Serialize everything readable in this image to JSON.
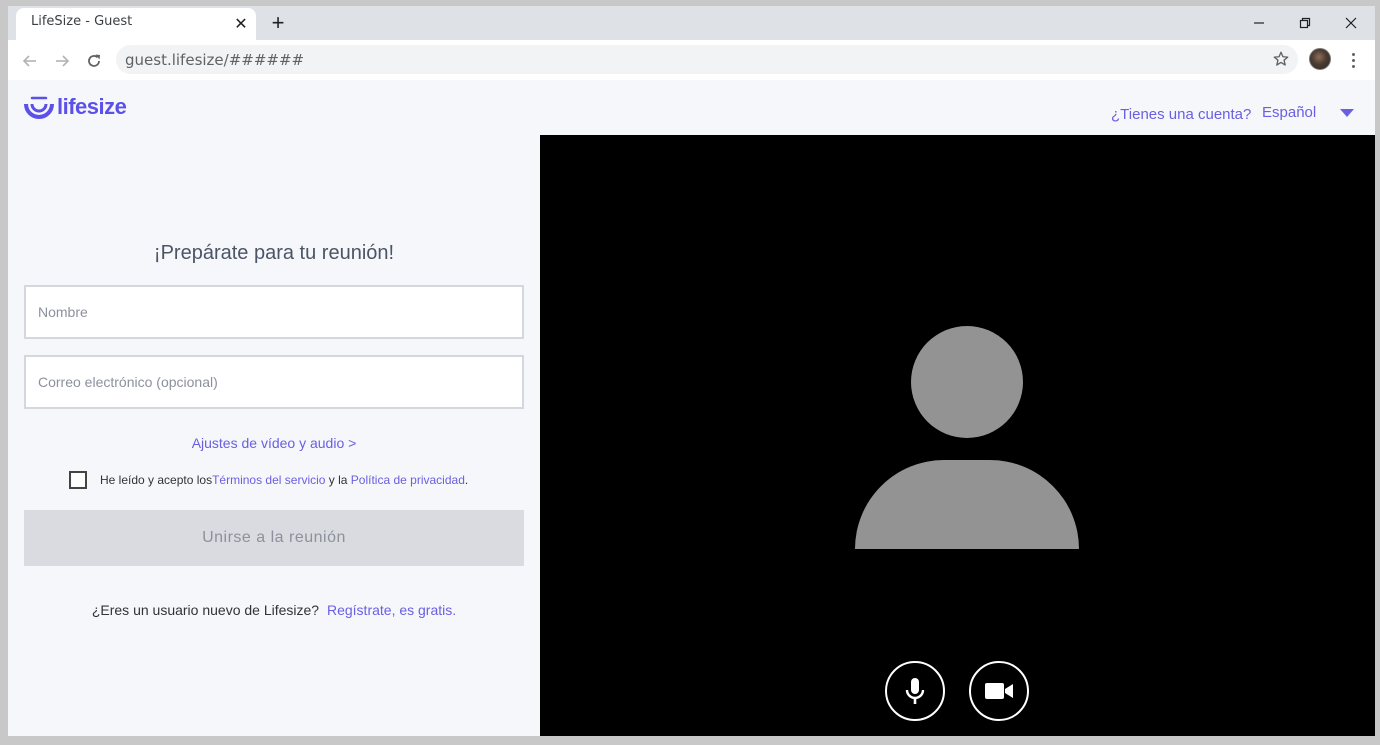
{
  "browser": {
    "tab_title": "LifeSize - Guest",
    "tab_close": "✕",
    "new_tab": "+",
    "url": "guest.lifesize/######"
  },
  "header": {
    "logo_text": "lifesize",
    "account_link": "¿Tienes una cuenta?",
    "language": "Español"
  },
  "form": {
    "title": "¡Prepárate para tu reunión!",
    "name_placeholder": "Nombre",
    "email_placeholder": "Correo electrónico (opcional)",
    "settings_link": "Ajustes de vídeo y audio >",
    "terms_prefix": "He leído y acepto los ",
    "terms_link": "Términos del servicio",
    "terms_middle": " y la ",
    "privacy_link": "Política de privacidad",
    "terms_suffix": ".",
    "join_button": "Unirse a la reunión",
    "signup_question": "¿Eres un usuario nuevo de Lifesize?",
    "signup_link": "Regístrate, es gratis."
  },
  "video_controls": {
    "mic_icon": "microphone-icon",
    "camera_icon": "video-camera-icon"
  },
  "colors": {
    "accent": "#6a5fe0",
    "logo": "#5b50e8",
    "video_bg": "#000000",
    "placeholder": "#939393"
  }
}
